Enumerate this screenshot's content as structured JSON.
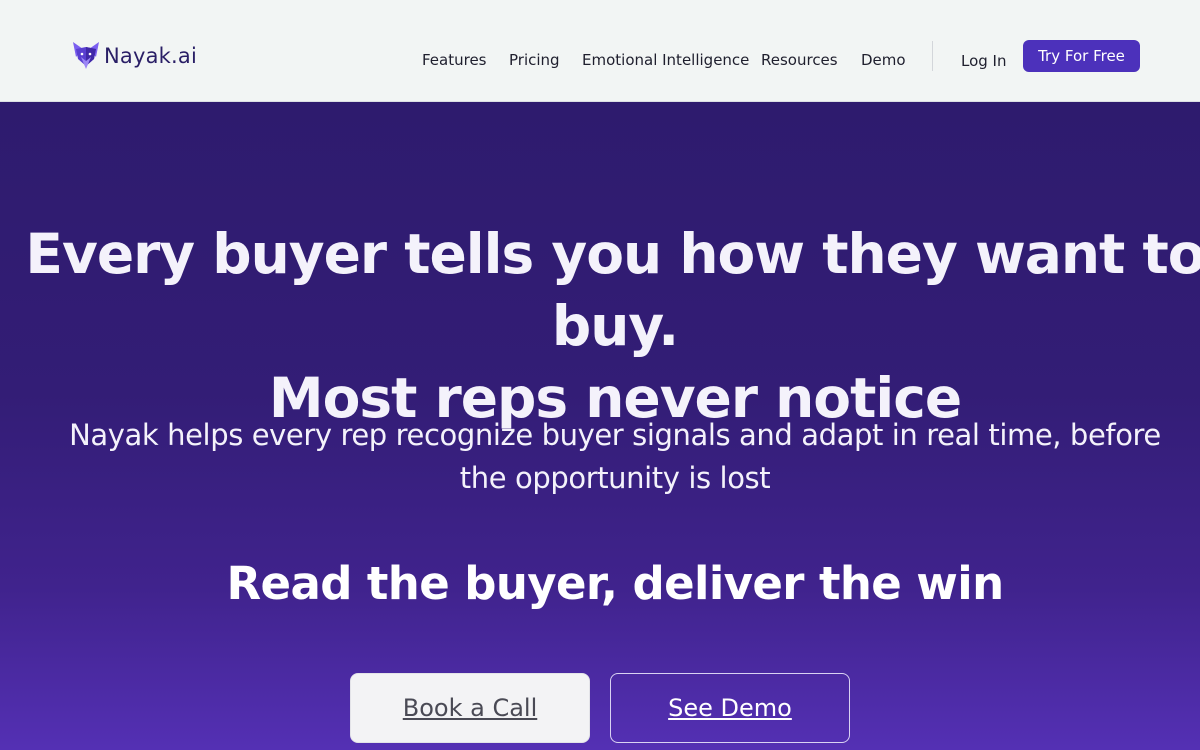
{
  "brand": {
    "name": "Nayak.ai",
    "logo_icon": "fox-head-icon",
    "color_primary": "#4c31bb",
    "color_dark": "#2e1b6e"
  },
  "nav": {
    "items": [
      {
        "label": "Features"
      },
      {
        "label": "Pricing"
      },
      {
        "label": "Emotional Intelligence"
      },
      {
        "label": "Resources"
      },
      {
        "label": "Demo"
      }
    ],
    "login_label": "Log In",
    "cta_label": "Try For Free"
  },
  "hero": {
    "headline_line1": "Every buyer tells you how they want to buy.",
    "headline_line2": "Most reps never notice",
    "subhead_line1": "Nayak helps every rep recognize buyer signals and adapt in real time, before",
    "subhead_line2": "the opportunity is lost",
    "tagline": "Read the buyer, deliver the win",
    "primary_cta": "Book a Call",
    "secondary_cta": "See Demo"
  }
}
